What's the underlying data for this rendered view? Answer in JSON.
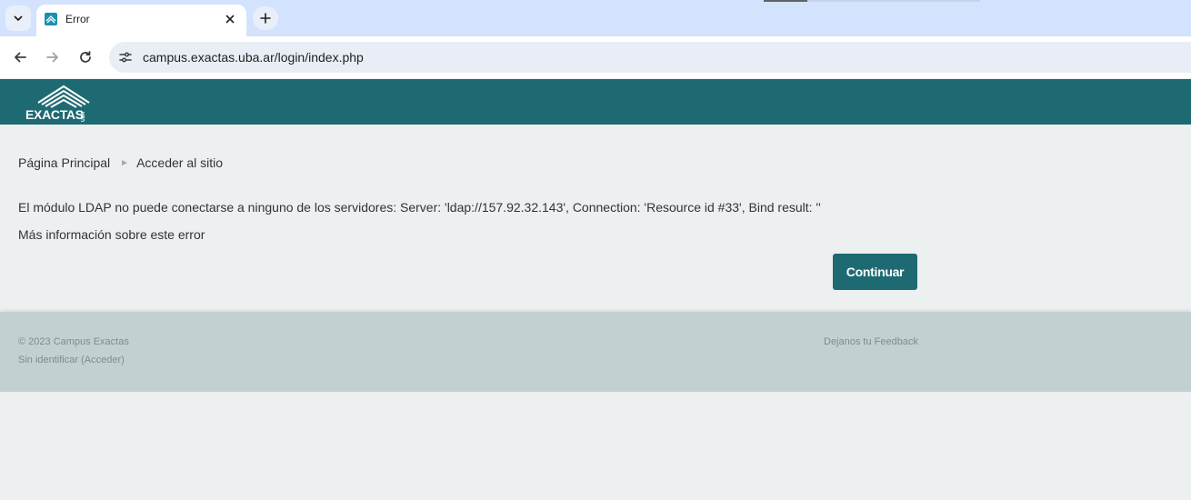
{
  "browser": {
    "tab_title": "Error",
    "url": "campus.exactas.uba.ar/login/index.php",
    "icons": [
      "tab-dropdown-icon",
      "favicon-icon",
      "close-icon",
      "plus-icon",
      "back-arrow-icon",
      "forward-arrow-icon",
      "reload-icon",
      "site-settings-icon"
    ]
  },
  "header": {
    "logo_text": "EXACTAS",
    "logo_sub": "UBA",
    "color": "#1e6a73"
  },
  "breadcrumb": {
    "home": "Página Principal",
    "current": "Acceder al sitio",
    "separator": "►"
  },
  "error": {
    "message": "El módulo LDAP no puede conectarse a ninguno de los servidores: Server: 'ldap://157.92.32.143', Connection: 'Resource id #33', Bind result: ''",
    "more_info": "Más información sobre este error"
  },
  "actions": {
    "continue_label": "Continuar"
  },
  "footer": {
    "copyright": "© 2023 Campus Exactas",
    "login_status": "Sin identificar (Acceder)",
    "feedback": "Dejanos tu Feedback"
  }
}
